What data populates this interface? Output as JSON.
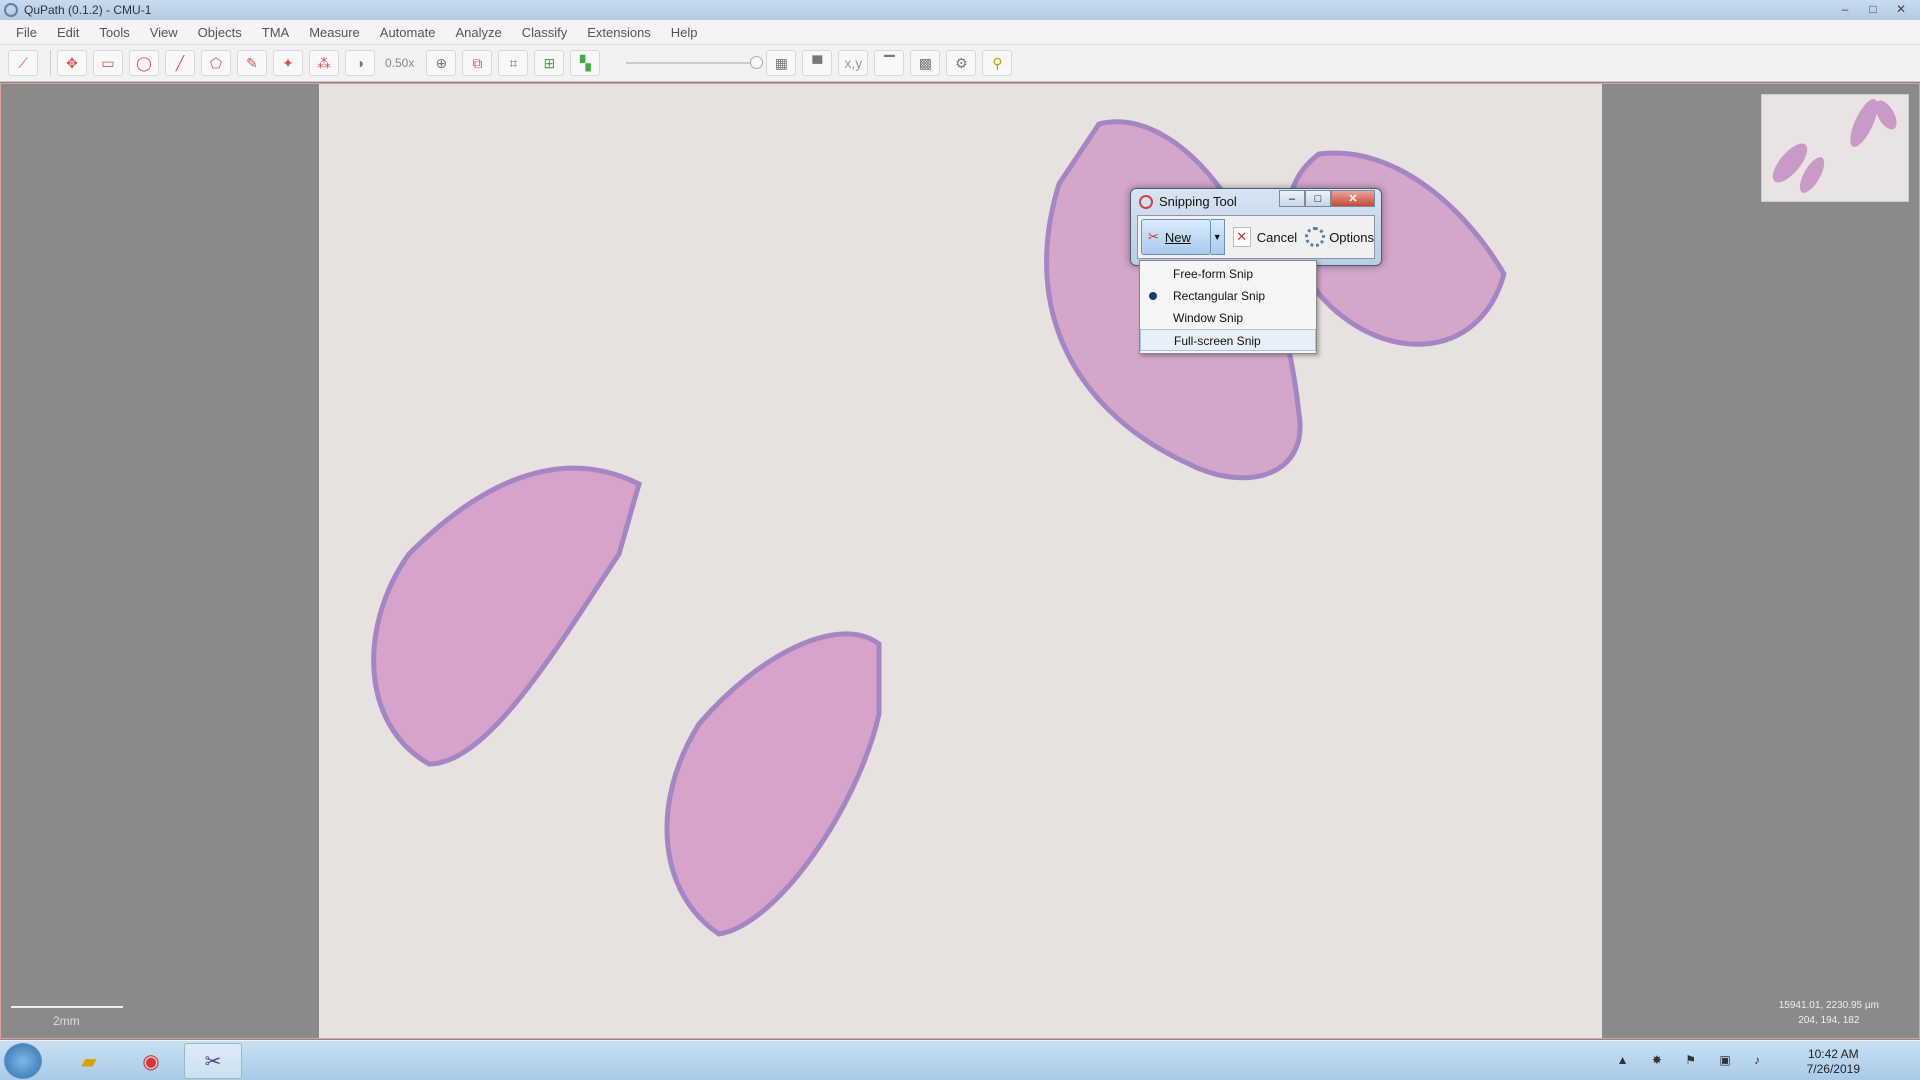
{
  "window": {
    "title": "QuPath (0.1.2) - CMU-1"
  },
  "menu": [
    "File",
    "Edit",
    "Tools",
    "View",
    "Objects",
    "TMA",
    "Measure",
    "Automate",
    "Analyze",
    "Classify",
    "Extensions",
    "Help"
  ],
  "toolbar": {
    "zoom": "0.50x"
  },
  "viewer": {
    "scale_label": "2mm",
    "coords_line1": "15941.01, 2230.95 µm",
    "coords_line2": "204, 194, 182"
  },
  "snipping_tool": {
    "title": "Snipping Tool",
    "new_label": "New",
    "cancel_label": "Cancel",
    "options_label": "Options",
    "modes": [
      {
        "label": "Free-form Snip",
        "selected": false
      },
      {
        "label": "Rectangular Snip",
        "selected": true
      },
      {
        "label": "Window Snip",
        "selected": false
      },
      {
        "label": "Full-screen Snip",
        "selected": false,
        "hovered": true
      }
    ]
  },
  "taskbar": {
    "time": "10:42 AM",
    "date": "7/26/2019"
  },
  "colors": {
    "tissue": "#d49ac6",
    "tissue_edge": "#9a7cbf",
    "slide_bg": "#e7e2df"
  }
}
